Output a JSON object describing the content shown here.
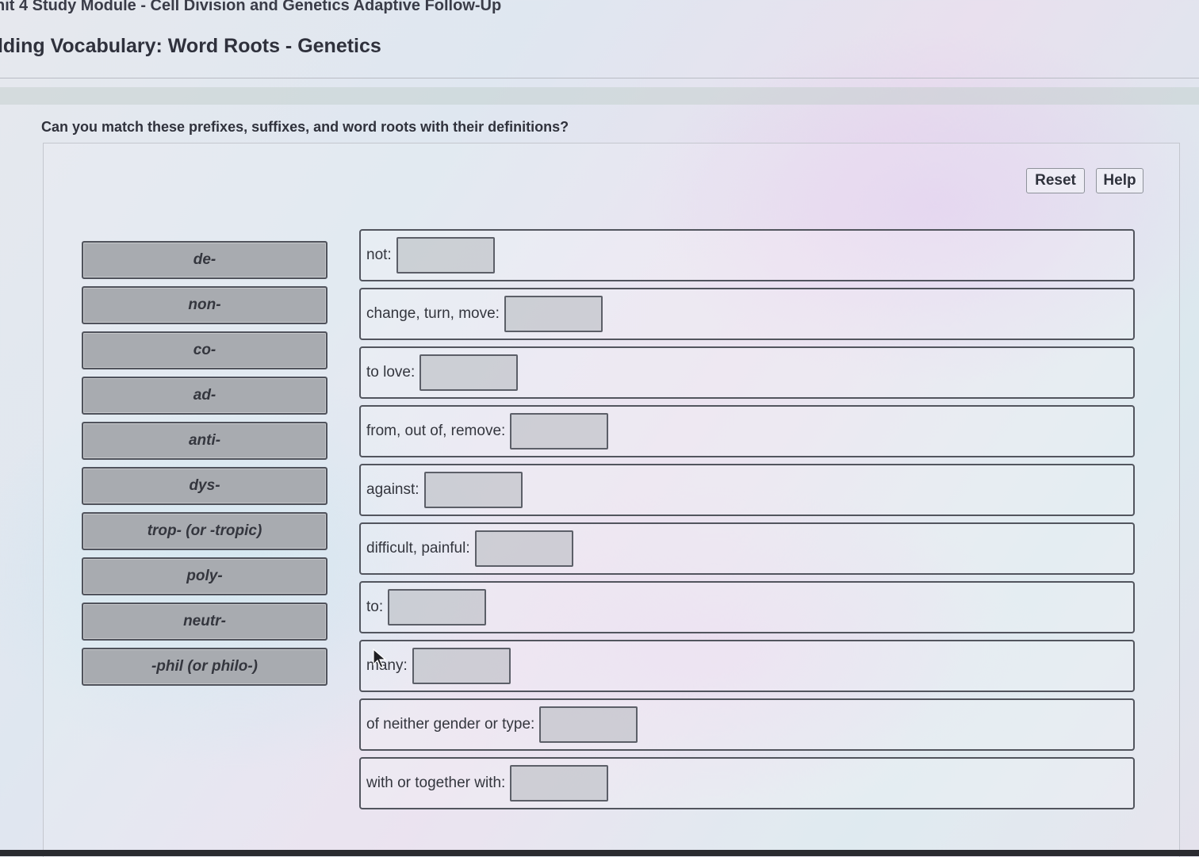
{
  "header": {
    "module_title": "nit 4 Study Module - Cell Division and Genetics Adaptive Follow-Up",
    "activity_title": "ilding Vocabulary: Word Roots - Genetics"
  },
  "instructions": "Can you match these prefixes, suffixes, and word roots with their definitions?",
  "toolbar": {
    "reset_label": "Reset",
    "help_label": "Help"
  },
  "terms": [
    {
      "label": "de-"
    },
    {
      "label": "non-"
    },
    {
      "label": "co-"
    },
    {
      "label": "ad-"
    },
    {
      "label": "anti-"
    },
    {
      "label": "dys-"
    },
    {
      "label": "trop- (or -tropic)"
    },
    {
      "label": "poly-"
    },
    {
      "label": "neutr-"
    },
    {
      "label": "-phil (or philo-)"
    }
  ],
  "definitions": [
    {
      "label": "not:",
      "answer": ""
    },
    {
      "label": "change, turn, move:",
      "answer": ""
    },
    {
      "label": "to love:",
      "answer": ""
    },
    {
      "label": "from, out of, remove:",
      "answer": ""
    },
    {
      "label": "against:",
      "answer": ""
    },
    {
      "label": "difficult, painful:",
      "answer": ""
    },
    {
      "label": "to:",
      "answer": ""
    },
    {
      "label": "many:",
      "answer": ""
    },
    {
      "label": "of neither gender or type:",
      "answer": ""
    },
    {
      "label": "with or together with:",
      "answer": ""
    }
  ],
  "colors": {
    "term_tile": "#a8abb0",
    "border": "#52555e",
    "drop_zone": "#a8acb2"
  }
}
